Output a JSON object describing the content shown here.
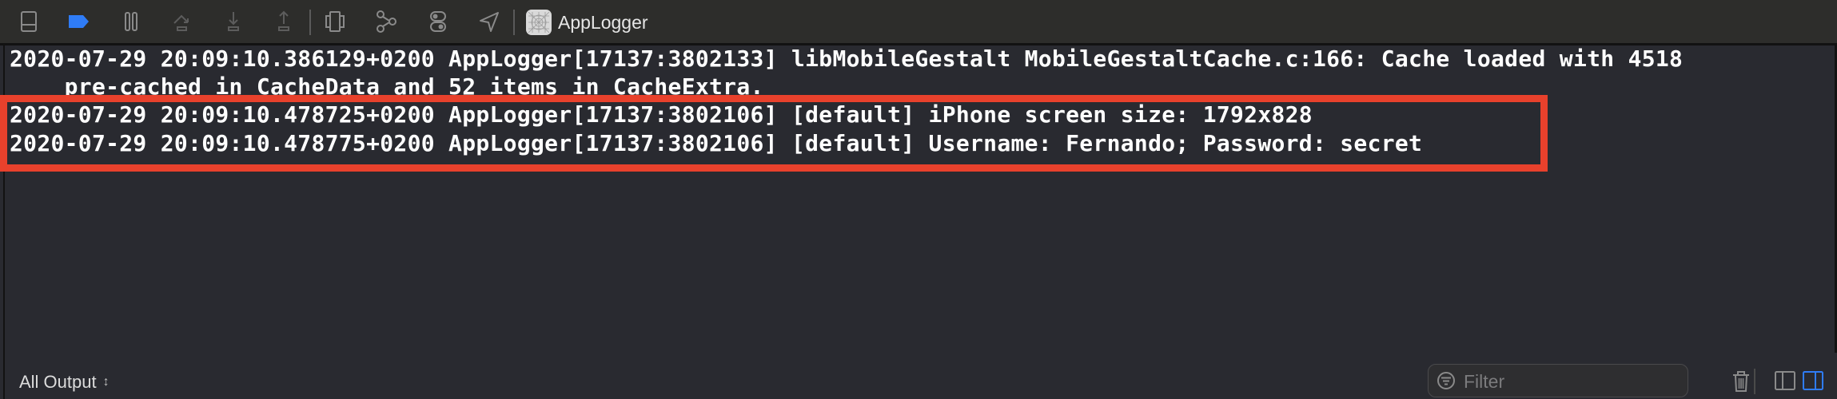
{
  "toolbar": {
    "icons": [
      {
        "name": "hide-debug-area-icon"
      },
      {
        "name": "breakpoints-toggle-icon",
        "color": "#2F7CF6"
      },
      {
        "name": "pause-icon"
      },
      {
        "name": "step-over-icon"
      },
      {
        "name": "step-into-icon"
      },
      {
        "name": "step-out-icon"
      },
      {
        "name": "debug-view-hierarchy-icon"
      },
      {
        "name": "memory-graph-icon"
      },
      {
        "name": "environment-overrides-icon"
      },
      {
        "name": "simulate-location-icon"
      }
    ],
    "app_name": "AppLogger"
  },
  "log": {
    "lines": [
      "2020-07-29 20:09:10.386129+0200 AppLogger[17137:3802133] libMobileGestalt MobileGestaltCache.c:166: Cache loaded with 4518",
      "    pre-cached in CacheData and 52 items in CacheExtra.",
      "2020-07-29 20:09:10.478725+0200 AppLogger[17137:3802106] [default] iPhone screen size: 1792x828",
      "2020-07-29 20:09:10.478775+0200 AppLogger[17137:3802106] [default] Username: Fernando; Password: secret"
    ],
    "highlight_color": "#E8412C"
  },
  "bottom_bar": {
    "scope_label": "All Output",
    "filter_placeholder": "Filter",
    "filter_value": "",
    "active_color": "#2F7CF6"
  }
}
